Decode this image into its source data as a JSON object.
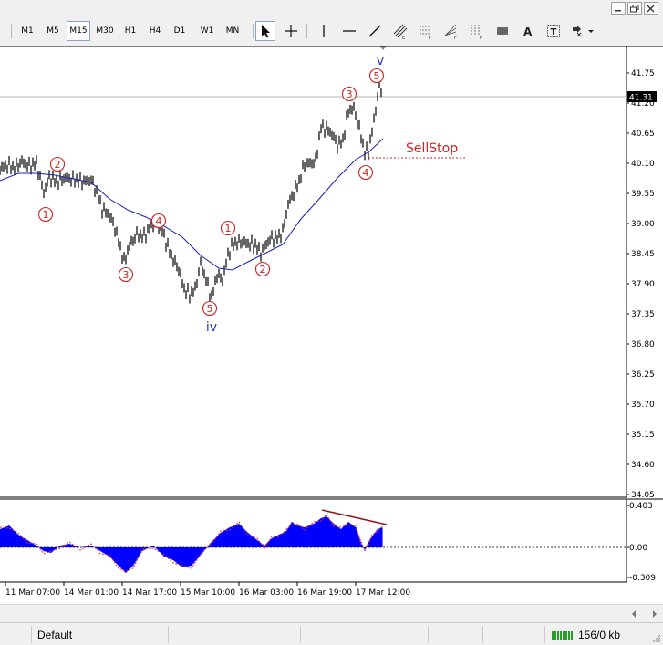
{
  "toolbar": {
    "timeframes": [
      "M1",
      "M5",
      "M15",
      "M30",
      "H1",
      "H4",
      "D1",
      "W1",
      "MN"
    ],
    "active_timeframe": "M15"
  },
  "chart": {
    "current_price": "41.31",
    "price_ticks": [
      "41.75",
      "41.20",
      "40.65",
      "40.10",
      "39.55",
      "39.00",
      "38.45",
      "37.90",
      "37.35",
      "36.80",
      "36.25",
      "35.70",
      "35.15",
      "34.60",
      "34.05"
    ],
    "wave_labels": {
      "minor": [
        "1",
        "2",
        "3",
        "4",
        "5",
        "1",
        "2",
        "3",
        "4",
        "5"
      ],
      "major": [
        "iv",
        "v"
      ]
    },
    "annotation": "SellStop"
  },
  "indicator": {
    "ticks": [
      "0.403",
      "0.00",
      "-0.309"
    ]
  },
  "time_axis": [
    "11 Mar 07:00",
    "14 Mar 01:00",
    "14 Mar 17:00",
    "15 Mar 10:00",
    "16 Mar 03:00",
    "16 Mar 19:00",
    "17 Mar 12:00"
  ],
  "status": {
    "profile": "Default",
    "traffic": "156/0 kb"
  },
  "colors": {
    "wave_red": "#d42020",
    "wave_blue": "#2838c8",
    "ma_line": "#1a22b0",
    "histogram": "#0000ff",
    "signal": "#e03030",
    "divergence": "#8b1c1c"
  }
}
